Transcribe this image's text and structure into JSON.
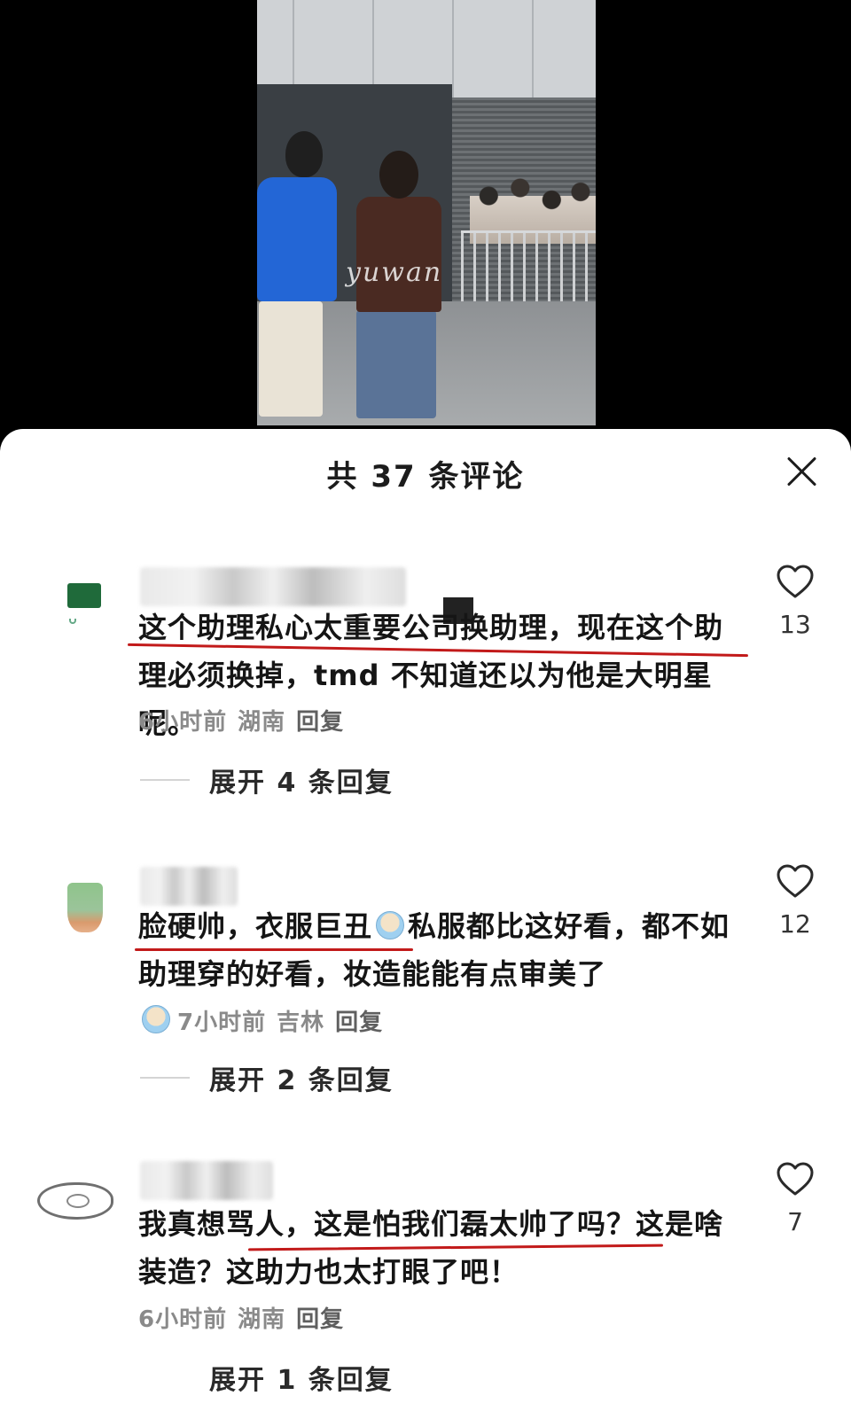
{
  "video": {
    "watermark": "yuwan"
  },
  "sheet": {
    "title": "共 37 条评论"
  },
  "comments": [
    {
      "text": "这个助理私心太重要公司换助理，现在这个助理必须换掉，tmd 不知道还以为他是大明星呢。",
      "time": "6小时前",
      "location": "湖南",
      "reply_label": "回复",
      "likes": "13",
      "expand_label": "展开 4 条回复"
    },
    {
      "text_part1": "脸硬帅，衣服巨丑",
      "text_part2": "私服都比这好看，都不如助理穿的好看，妆造能能有点审美了",
      "time": "7小时前",
      "location": "吉林",
      "reply_label": "回复",
      "likes": "12",
      "expand_label": "展开 2 条回复",
      "emoji": "crying-face-emoji"
    },
    {
      "text": "我真想骂人，这是怕我们磊太帅了吗？这是啥装造？这助力也太打眼了吧！",
      "time": "6小时前",
      "location": "湖南",
      "reply_label": "回复",
      "likes": "7",
      "expand_label": "展开 1 条回复"
    }
  ],
  "colors": {
    "underline": "#c21a1a",
    "blue_jacket": "#2366d6",
    "sheet_bg": "#ffffff"
  }
}
